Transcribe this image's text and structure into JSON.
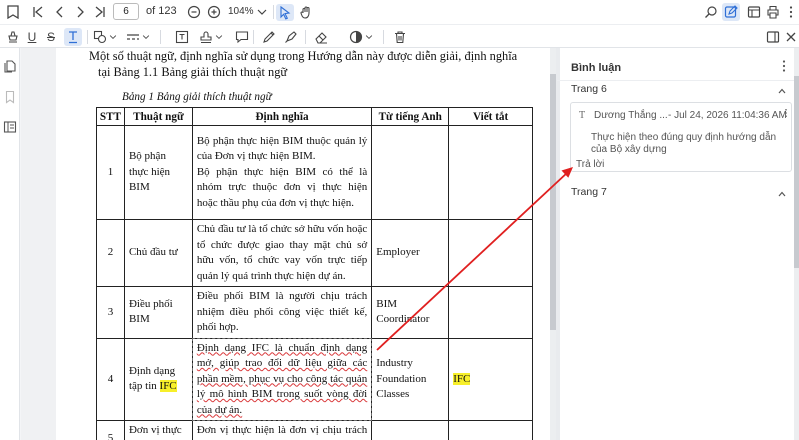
{
  "toolbar": {
    "current_page": "6",
    "page_count_label": "of 123",
    "zoom_label": "104%"
  },
  "document": {
    "paragraph_line1": "Một số thuật ngữ, định nghĩa sử dụng trong Hướng dẫn này được diễn giải, định nghĩa",
    "paragraph_line2": "tại Bảng 1.1 Bảng giải thích thuật ngữ",
    "table_caption": "Bảng 1 Bảng giải thích thuật ngữ",
    "table": {
      "headers": [
        "STT",
        "Thuật ngữ",
        "Định nghĩa",
        "Từ tiếng Anh",
        "Viết tắt"
      ],
      "rows": [
        {
          "stt": "1",
          "term": "Bộ phận thực hiện BIM",
          "definition_a": "Bộ phận thực hiện BIM thuộc quản lý của Đơn vị thực hiện BIM.",
          "definition_b": "Bộ phận thực hiện BIM có thể là nhóm trực thuộc đơn vị thực hiện hoặc thầu phụ của đơn vị thực hiện.",
          "english": "",
          "abbr": ""
        },
        {
          "stt": "2",
          "term": "Chủ đầu tư",
          "definition": "Chủ đầu tư là tổ chức sở hữu vốn hoặc tổ chức được giao thay mặt chủ sở hữu vốn, tổ chức vay vốn trực tiếp quản lý quá trình thực hiện dự án.",
          "english": "Employer",
          "abbr": ""
        },
        {
          "stt": "3",
          "term": "Điều phối BIM",
          "definition": "Điều phối BIM là người chịu trách nhiệm điều phối công việc thiết kế, phối hợp.",
          "english": "BIM Coordinator",
          "abbr": ""
        },
        {
          "stt": "4",
          "term_prefix": "Định dạng tập tin ",
          "term_highlight": "IFC",
          "definition": "Định dạng IFC là chuẩn định dạng mở, giúp trao đổi dữ liệu giữa các phần mềm, phục vụ cho công tác quản lý mô hình BIM trong suốt vòng đời của dự án.",
          "english": "Industry Foundation Classes",
          "abbr": "IFC"
        },
        {
          "stt": "5",
          "term": "Đơn vị thực hiện",
          "definition": "Đơn vị thực hiện là đơn vị chịu trách nhiệm chính trong quá trình thực hiện",
          "english": "",
          "abbr": ""
        }
      ]
    }
  },
  "comments_panel": {
    "title": "Bình luận",
    "sections": [
      {
        "label": "Trang 6",
        "comments": [
          {
            "author": "Dương Thắng ...",
            "date": "- Jul 24, 2026 11:04:36 AM",
            "body": "Thực hiện theo đúng quy định hướng dẫn của Bộ xây dựng",
            "reply_label": "Trả lời"
          }
        ]
      },
      {
        "label": "Trang 7",
        "comments": []
      }
    ]
  },
  "icons": {
    "top_left": [
      "print-icon",
      "first-page-icon",
      "prev-page-icon",
      "next-page-icon",
      "last-page-icon",
      "zoom-out-icon",
      "zoom-in-icon",
      "zoom-dropdown-icon",
      "select-cursor-icon",
      "hand-pan-icon"
    ],
    "top_right": [
      "search-icon",
      "edit-annotate-icon",
      "sidebar-layout-icon",
      "printer-icon",
      "more-icon"
    ]
  },
  "colors": {
    "highlight": "#f7ef2a",
    "squiggle": "#d9383a",
    "arrow": "#e02020",
    "active_tool": "#2f6fd6"
  }
}
